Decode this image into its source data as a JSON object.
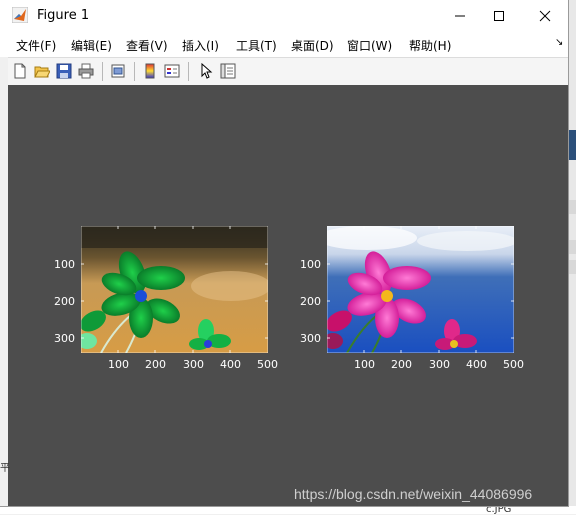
{
  "window": {
    "title": "Figure 1"
  },
  "menu": {
    "items": [
      {
        "label": "文件(F)"
      },
      {
        "label": "编辑(E)"
      },
      {
        "label": "查看(V)"
      },
      {
        "label": "插入(I)"
      },
      {
        "label": "工具(T)"
      },
      {
        "label": "桌面(D)"
      },
      {
        "label": "窗口(W)"
      },
      {
        "label": "帮助(H)"
      }
    ]
  },
  "toolbar": {
    "buttons": [
      "new-figure-icon",
      "open-file-icon",
      "save-icon",
      "print-icon",
      "print-preview-icon",
      "colorbar-icon",
      "legend-icon",
      "pointer-icon",
      "property-editor-icon"
    ]
  },
  "axes_left": {
    "yticks": [
      "100",
      "200",
      "300"
    ],
    "xticks": [
      "100",
      "200",
      "300",
      "400",
      "500"
    ]
  },
  "axes_right": {
    "yticks": [
      "100",
      "200",
      "300"
    ],
    "xticks": [
      "100",
      "200",
      "300",
      "400",
      "500"
    ]
  },
  "watermark": "https://blog.csdn.net/weixin_44086996",
  "background": {
    "bottom_right_text": "c.JPG",
    "left_text": "平"
  },
  "colors": {
    "figure_bg": "#4d4d4d",
    "window_bg": "#f0f0f0",
    "tick_text": "#ffffff"
  }
}
